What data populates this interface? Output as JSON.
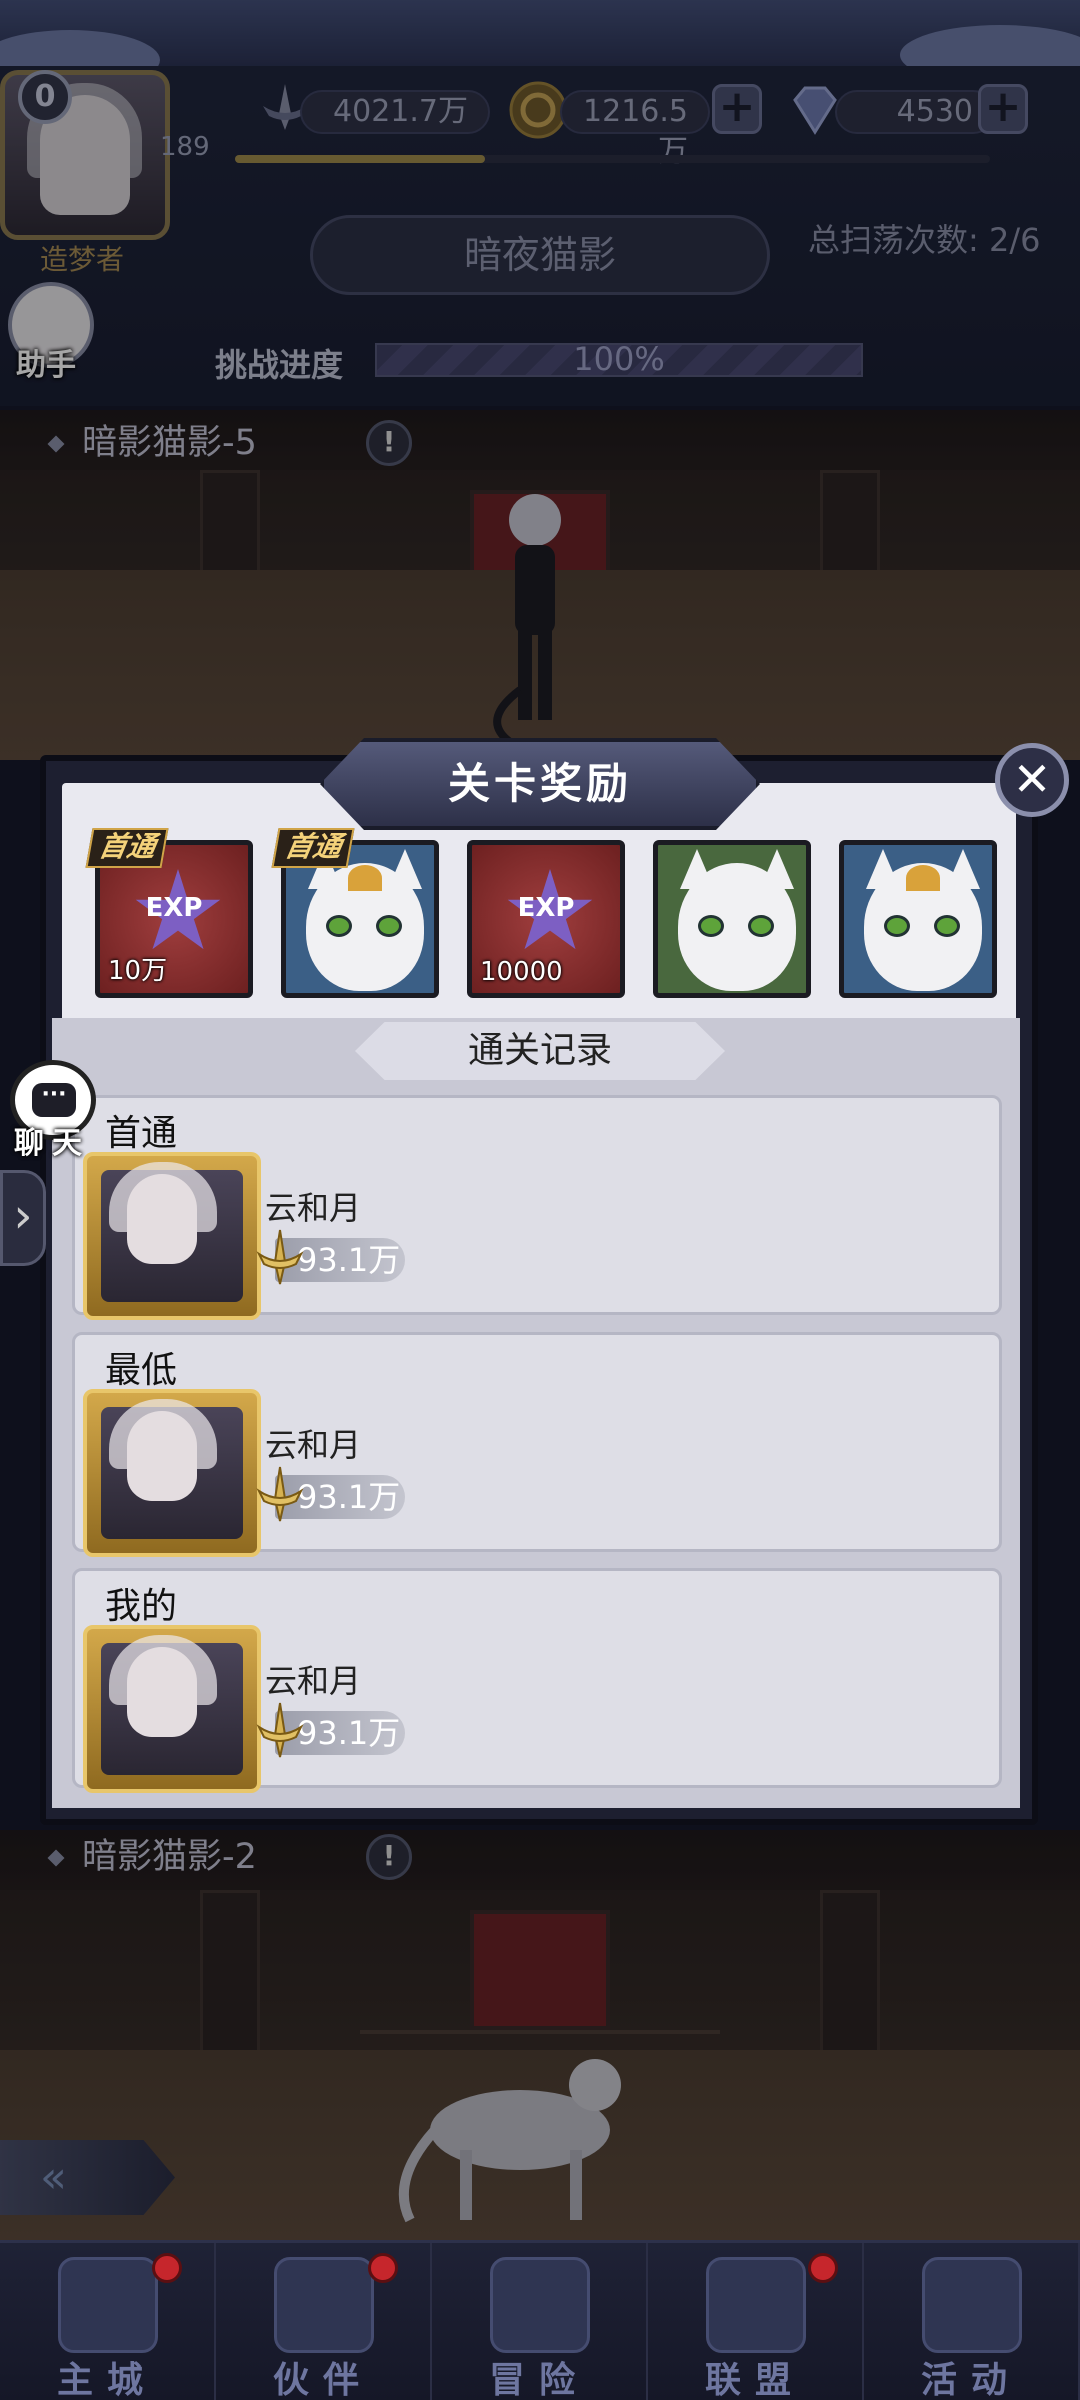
{
  "hud": {
    "level": "0",
    "level_number": "189",
    "player_title": "造梦者",
    "power": "4021.7万",
    "gold": "1216.5万",
    "diamonds": "4530",
    "stage_name": "暗夜猫影",
    "sweep_count": "总扫荡次数: 2/6",
    "assistant_label": "助手",
    "progress_label": "挑战进度",
    "progress_value": "100%"
  },
  "stages": {
    "upper_title": "暗影猫影-5",
    "lower_title": "暗影猫影-2"
  },
  "popup": {
    "title": "关卡奖励",
    "rewards": [
      {
        "tag": "首通",
        "type": "exp",
        "amount": "10万"
      },
      {
        "tag": "首通",
        "type": "white-cat-crowned",
        "amount": ""
      },
      {
        "tag": "",
        "type": "exp",
        "amount": "10000"
      },
      {
        "tag": "",
        "type": "white-cat",
        "amount": ""
      },
      {
        "tag": "",
        "type": "white-cat-crowned",
        "amount": ""
      }
    ],
    "exp_label": "EXP",
    "records_header": "通关记录",
    "records": [
      {
        "title": "首通",
        "name": "云和月",
        "power": "93.1万"
      },
      {
        "title": "最低",
        "name": "云和月",
        "power": "93.1万"
      },
      {
        "title": "我的",
        "name": "云和月",
        "power": "93.1万"
      }
    ]
  },
  "side": {
    "chat_label": "聊天",
    "chat_bubble": "···"
  },
  "nav": [
    {
      "label": "主城",
      "badge": true
    },
    {
      "label": "伙伴",
      "badge": true
    },
    {
      "label": "冒险",
      "badge": false
    },
    {
      "label": "联盟",
      "badge": true
    },
    {
      "label": "活动",
      "badge": false
    }
  ],
  "colors": {
    "accent_gold": "#d0a448",
    "badge_red": "#c6262c",
    "panel": "#e9e9f0"
  }
}
